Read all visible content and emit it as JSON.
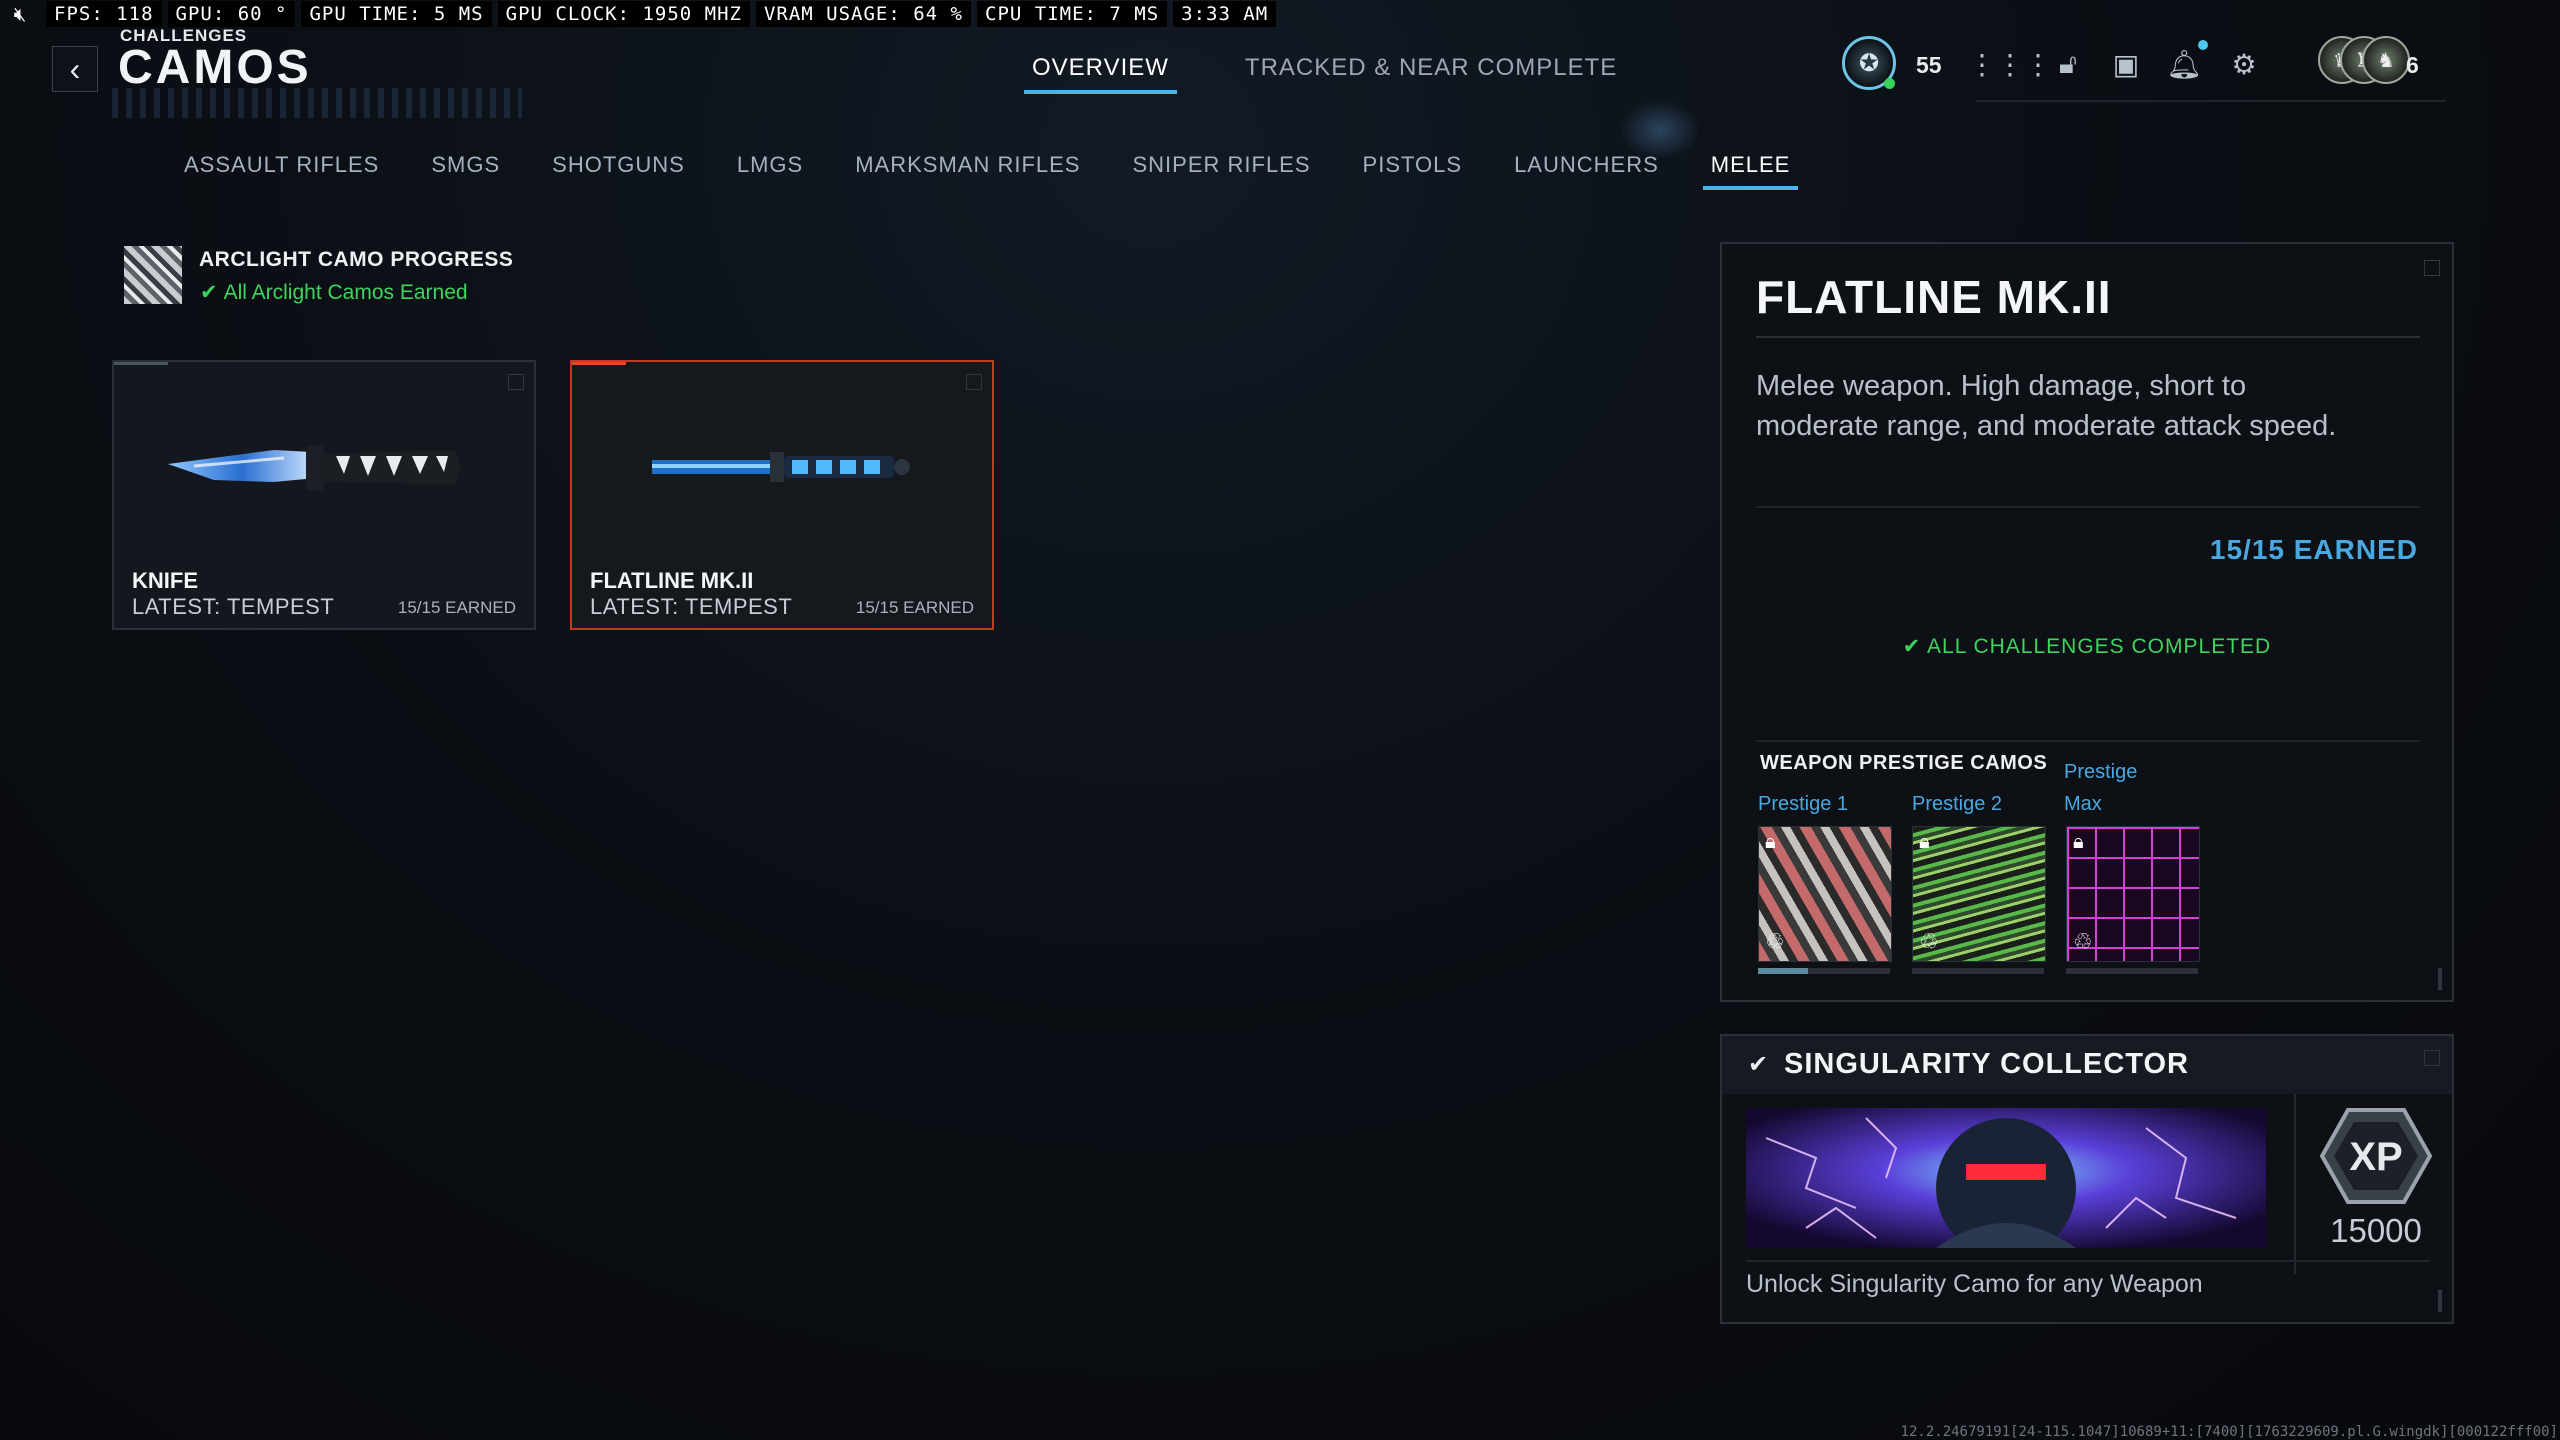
{
  "perf": {
    "fps": "FPS: 118",
    "gpu": "GPU: 60 °",
    "gpu_time": "GPU TIME:  5 MS",
    "gpu_clock": "GPU CLOCK: 1950 MHZ",
    "vram": "VRAM USAGE: 64 %",
    "cpu_time": "CPU TIME:  7 MS",
    "clock": "3:33 AM"
  },
  "header": {
    "supertitle": "CHALLENGES",
    "title": "CAMOS",
    "tabs": [
      {
        "label": "OVERVIEW",
        "active": true
      },
      {
        "label": "TRACKED & NEAR COMPLETE",
        "active": false
      }
    ]
  },
  "hud": {
    "level": "55",
    "party_count": "6",
    "icons": [
      "grid-icon",
      "unlock-icon",
      "camera-icon",
      "bell-icon",
      "gear-icon"
    ]
  },
  "categories": [
    {
      "label": "ASSAULT RIFLES",
      "active": false
    },
    {
      "label": "SMGS",
      "active": false
    },
    {
      "label": "SHOTGUNS",
      "active": false
    },
    {
      "label": "LMGS",
      "active": false
    },
    {
      "label": "MARKSMAN RIFLES",
      "active": false
    },
    {
      "label": "SNIPER RIFLES",
      "active": false
    },
    {
      "label": "PISTOLS",
      "active": false
    },
    {
      "label": "LAUNCHERS",
      "active": false
    },
    {
      "label": "MELEE",
      "active": true
    }
  ],
  "arclight": {
    "title": "ARCLIGHT CAMO PROGRESS",
    "status": "All Arclight Camos Earned"
  },
  "weapons": [
    {
      "name": "KNIFE",
      "latest": "LATEST: TEMPEST",
      "earned": "15/15 EARNED",
      "selected": false
    },
    {
      "name": "FLATLINE MK.II",
      "latest": "LATEST: TEMPEST",
      "earned": "15/15 EARNED",
      "selected": true
    }
  ],
  "details": {
    "title": "FLATLINE MK.II",
    "description": "Melee weapon. High damage, short to moderate range, and moderate attack speed.",
    "earned": "15/15 EARNED",
    "complete": "ALL CHALLENGES COMPLETED",
    "prestige_title": "WEAPON PRESTIGE CAMOS",
    "prestige": [
      {
        "label": "Prestige 1",
        "progress": 0.38
      },
      {
        "label": "Prestige 2",
        "progress": 0.0
      },
      {
        "label": "Prestige Max",
        "progress": 0.0
      }
    ]
  },
  "collector": {
    "title": "SINGULARITY COLLECTOR",
    "xp_label": "XP",
    "xp": "15000",
    "description": "Unlock Singularity Camo for any Weapon"
  },
  "footer_code": "12.2.24679191[24-115.1047]10689+11:[7400][1763229609.pl.G.wingdk][000122fff00]",
  "colors": {
    "accent_blue": "#4aa8e0",
    "success_green": "#3ed45d",
    "selected_border": "#c23a22"
  }
}
